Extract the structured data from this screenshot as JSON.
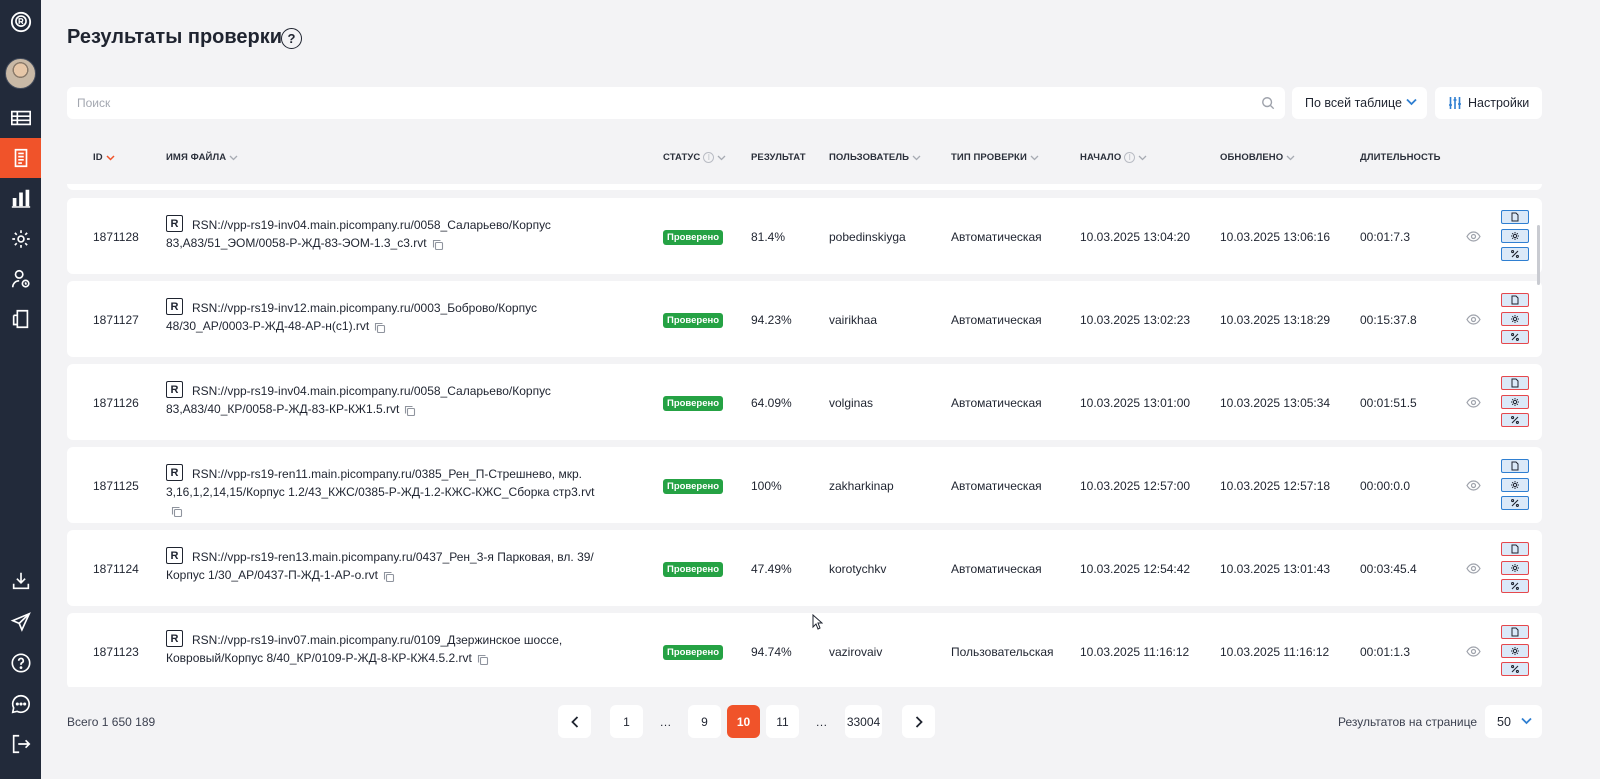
{
  "page": {
    "title": "Результаты проверки"
  },
  "search": {
    "placeholder": "Поиск"
  },
  "scope": {
    "label": "По всей таблице"
  },
  "settings": {
    "label": "Настройки"
  },
  "columns": {
    "id": "ID",
    "file": "Имя файла",
    "status": "Статус",
    "result": "Результат",
    "user": "Пользователь",
    "type": "Тип проверки",
    "start": "Начало",
    "updated": "Обновлено",
    "duration": "Длительность"
  },
  "rows": [
    {
      "id": "1871128",
      "file_line1": "RSN://vpp-rs19-inv04.main.picompany.ru/0058_Саларьево/Корпус",
      "file_line2": "83,А83/51_ЭОМ/0058-Р-ЖД-83-ЭОМ-1.3_с3.rvt",
      "status": "Проверено",
      "result": "81.4%",
      "user": "pobedinskiyga",
      "type": "Автоматическая",
      "start": "10.03.2025 13:04:20",
      "updated": "10.03.2025 13:06:16",
      "duration": "00:01:7.3",
      "actions_variant": "blue"
    },
    {
      "id": "1871127",
      "file_line1": "RSN://vpp-rs19-inv12.main.picompany.ru/0003_Боброво/Корпус",
      "file_line2": "48/30_АР/0003-Р-ЖД-48-АР-н(с1).rvt",
      "status": "Проверено",
      "result": "94.23%",
      "user": "vairikhaa",
      "type": "Автоматическая",
      "start": "10.03.2025 13:02:23",
      "updated": "10.03.2025 13:18:29",
      "duration": "00:15:37.8",
      "actions_variant": "red"
    },
    {
      "id": "1871126",
      "file_line1": "RSN://vpp-rs19-inv04.main.picompany.ru/0058_Саларьево/Корпус",
      "file_line2": "83,А83/40_КР/0058-Р-ЖД-83-КР-КЖ1.5.rvt",
      "status": "Проверено",
      "result": "64.09%",
      "user": "volginas",
      "type": "Автоматическая",
      "start": "10.03.2025 13:01:00",
      "updated": "10.03.2025 13:05:34",
      "duration": "00:01:51.5",
      "actions_variant": "red"
    },
    {
      "id": "1871125",
      "file_line1": "RSN://vpp-rs19-ren11.main.picompany.ru/0385_Рен_П-Стрешнево, мкр.",
      "file_line2": "3,16,1,2,14,15/Корпус 1.2/43_КЖС/0385-Р-ЖД-1.2-КЖС-КЖС_Сборка стр3.rvt",
      "status": "Проверено",
      "result": "100%",
      "user": "zakharkinap",
      "type": "Автоматическая",
      "start": "10.03.2025 12:57:00",
      "updated": "10.03.2025 12:57:18",
      "duration": "00:00:0.0",
      "actions_variant": "blue"
    },
    {
      "id": "1871124",
      "file_line1": "RSN://vpp-rs19-ren13.main.picompany.ru/0437_Рен_3-я Парковая, вл. 39/",
      "file_line2": "Корпус 1/30_АР/0437-П-ЖД-1-АР-о.rvt",
      "status": "Проверено",
      "result": "47.49%",
      "user": "korotychkv",
      "type": "Автоматическая",
      "start": "10.03.2025 12:54:42",
      "updated": "10.03.2025 13:01:43",
      "duration": "00:03:45.4",
      "actions_variant": "red"
    },
    {
      "id": "1871123",
      "file_line1": "RSN://vpp-rs19-inv07.main.picompany.ru/0109_Дзержинское шоссе,",
      "file_line2": "Ковровый/Корпус 8/40_КР/0109-Р-ЖД-8-КР-КЖ4.5.2.rvt",
      "status": "Проверено",
      "result": "94.74%",
      "user": "vazirovaiv",
      "type": "Пользовательская",
      "start": "10.03.2025 11:16:12",
      "updated": "10.03.2025 11:16:12",
      "duration": "00:01:1.3",
      "actions_variant": "red"
    }
  ],
  "footer": {
    "total": "Всего 1 650 189",
    "pages": [
      "1",
      "…",
      "9",
      "10",
      "11",
      "…",
      "33004"
    ],
    "current_page": "10",
    "per_page_label": "Результатов на странице",
    "per_page_value": "50"
  },
  "colors": {
    "accent": "#f0532a",
    "sidebar": "#222a3a",
    "status_ok": "#25a244"
  }
}
